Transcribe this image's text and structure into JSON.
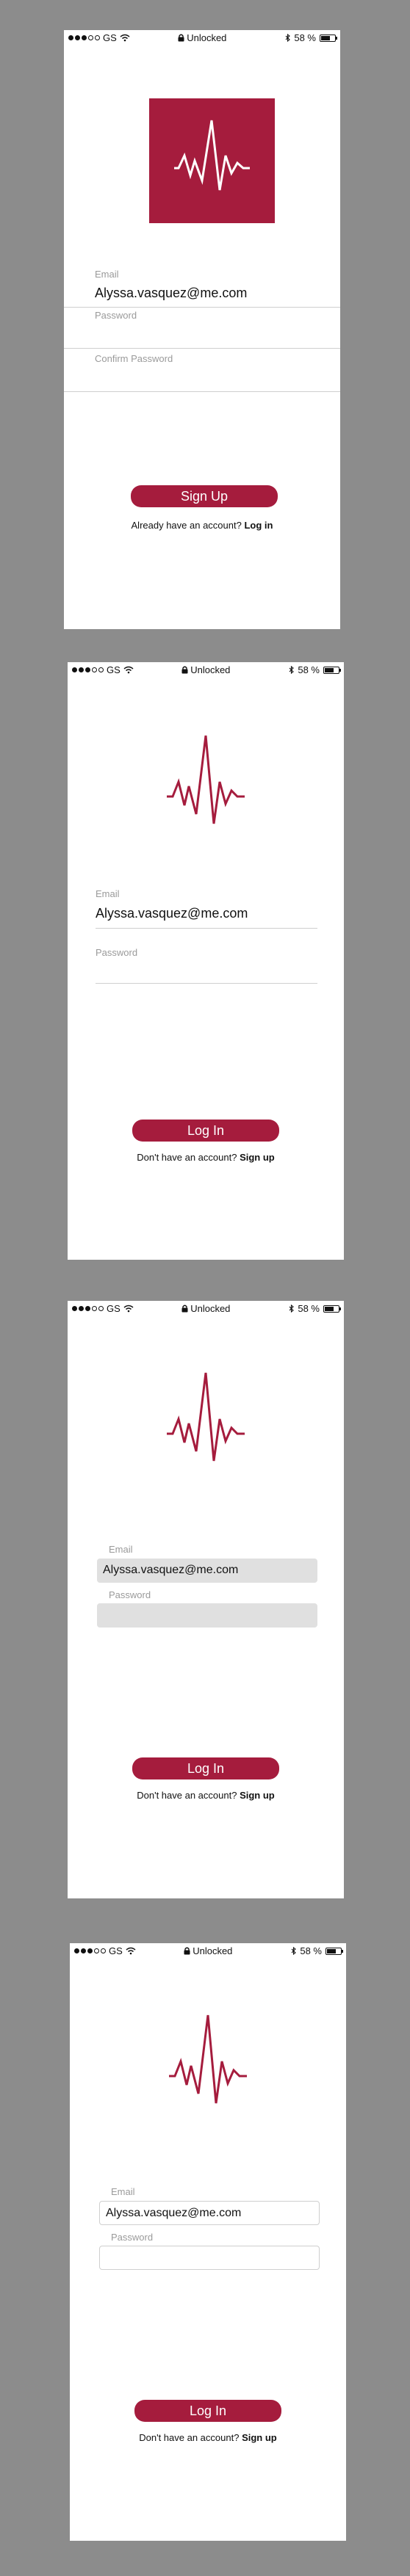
{
  "status_bar": {
    "carrier": "GS",
    "lock_text": "Unlocked",
    "battery": "58 %",
    "battery_level": 0.58
  },
  "screens": [
    {
      "email_label": "Email",
      "email_value": "Alyssa.vasquez@me.com",
      "password_label": "Password",
      "confirm_label": "Confirm Password",
      "button_label": "Sign Up",
      "footer_text": "Already have an account?",
      "footer_link": "Log in"
    },
    {
      "email_label": "Email",
      "email_value": "Alyssa.vasquez@me.com",
      "password_label": "Password",
      "button_label": "Log In",
      "footer_text": "Don't have an account?",
      "footer_link": "Sign up"
    },
    {
      "email_label": "Email",
      "email_value": "Alyssa.vasquez@me.com",
      "password_label": "Password",
      "button_label": "Log In",
      "footer_text": "Don't have an account?",
      "footer_link": "Sign up"
    },
    {
      "email_label": "Email",
      "email_value": "Alyssa.vasquez@me.com",
      "password_label": "Password",
      "button_label": "Log In",
      "footer_text": "Don't have an account?",
      "footer_link": "Sign up"
    }
  ],
  "colors": {
    "brand": "#a51c3d",
    "background": "#8c8c8c"
  },
  "icons": {
    "logo": "heartbeat-pulse-icon",
    "wifi": "wifi-icon",
    "lock": "lock-icon",
    "bluetooth": "bluetooth-icon",
    "battery": "battery-icon"
  }
}
